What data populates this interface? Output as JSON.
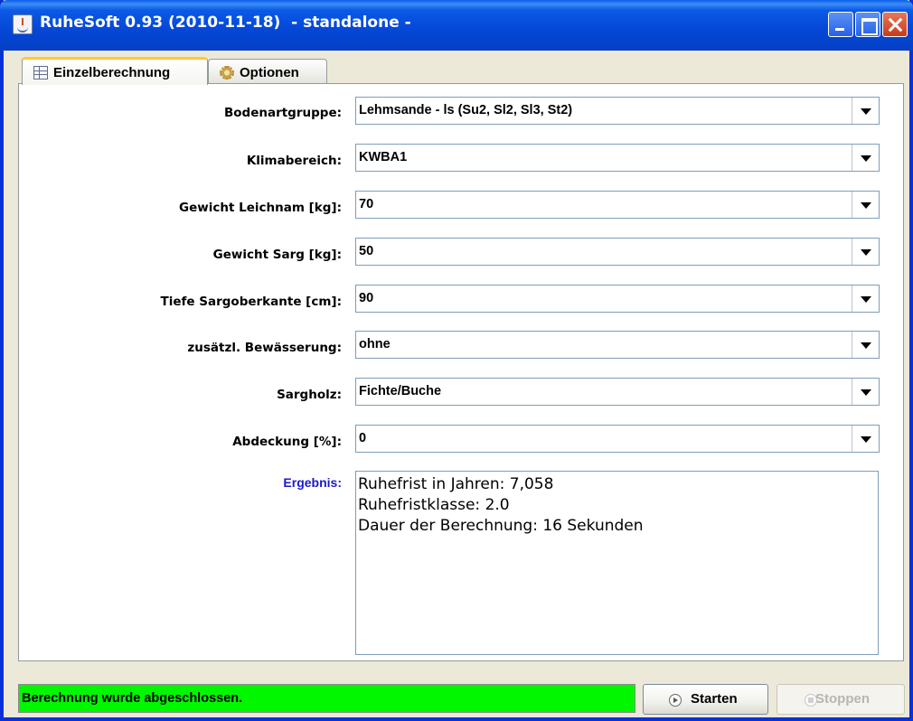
{
  "window": {
    "title": "RuheSoft 0.93 (2010-11-18)  - standalone -"
  },
  "tabs": [
    {
      "label": "Einzelberechnung",
      "icon": "table-icon",
      "active": true
    },
    {
      "label": "Optionen",
      "icon": "gear-icon",
      "active": false
    }
  ],
  "form": {
    "fields": [
      {
        "label": "Bodenartgruppe:",
        "value": "Lehmsande - ls (Su2, Sl2, Sl3, St2)"
      },
      {
        "label": "Klimabereich:",
        "value": "KWBA1"
      },
      {
        "label": "Gewicht Leichnam [kg]:",
        "value": "70"
      },
      {
        "label": "Gewicht Sarg [kg]:",
        "value": "50"
      },
      {
        "label": "Tiefe Sargoberkante [cm]:",
        "value": "90"
      },
      {
        "label": "zusätzl. Bewässerung:",
        "value": "ohne"
      },
      {
        "label": "Sargholz:",
        "value": "Fichte/Buche"
      },
      {
        "label": "Abdeckung [%]:",
        "value": "0"
      }
    ]
  },
  "result": {
    "label": "Ergebnis:",
    "lines": [
      "Ruhefrist in Jahren: 7,058",
      "Ruhefristklasse: 2.0",
      "Dauer der Berechnung: 16 Sekunden"
    ]
  },
  "status": {
    "text": "Berechnung wurde abgeschlossen.",
    "color": "#00f700"
  },
  "buttons": {
    "start_label": "Starten",
    "stop_label": "Stoppen",
    "stop_enabled": false
  },
  "colors": {
    "titlebar": "#0546d6",
    "result_label": "#1a1acd"
  }
}
